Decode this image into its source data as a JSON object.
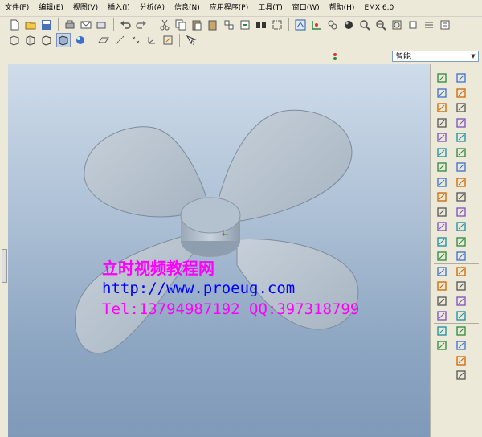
{
  "menubar": {
    "items": [
      "文件(F)",
      "编辑(E)",
      "视图(V)",
      "插入(I)",
      "分析(A)",
      "信息(N)",
      "应用程序(P)",
      "工具(T)",
      "窗口(W)",
      "帮助(H)",
      "EMX 6.0"
    ]
  },
  "toolbar": {
    "filter_value": "智能"
  },
  "watermark": {
    "title": "立时视频教程网",
    "url": "http://www.proeug.com",
    "contact": "Tel:13794987192  QQ:397318799"
  },
  "colors": {
    "background_top": "#cfdcea",
    "background_bottom": "#7f99b8",
    "model": "#b7c3cf",
    "watermark_magenta": "#ff00ff",
    "watermark_blue": "#0000ff"
  }
}
